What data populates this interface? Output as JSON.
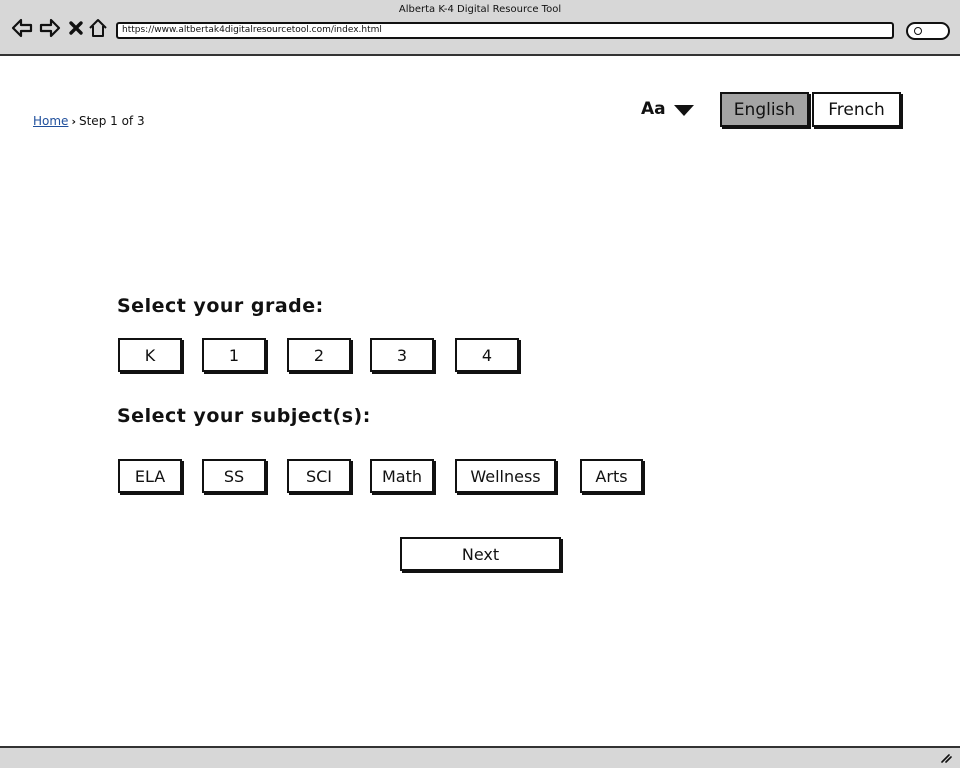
{
  "browser": {
    "window_title": "Alberta K-4 Digital Resource Tool",
    "url": "https://www.altbertak4digitalresourcetool.com/index.html"
  },
  "breadcrumb": {
    "home": "Home",
    "current": "Step 1 of 3"
  },
  "header": {
    "font_size_label": "Aa",
    "languages": [
      {
        "label": "English",
        "selected": true
      },
      {
        "label": "French",
        "selected": false
      }
    ]
  },
  "grade": {
    "label": "Select your grade:",
    "options": [
      "K",
      "1",
      "2",
      "3",
      "4"
    ]
  },
  "subject": {
    "label": "Select your subject(s):",
    "options": [
      "ELA",
      "SS",
      "SCI",
      "Math",
      "Wellness",
      "Arts"
    ]
  },
  "actions": {
    "next": "Next"
  },
  "colors": {
    "selected_language_bg": "#a4a4a4",
    "link": "#1f4f9c",
    "chrome_bg": "#d7d7d7"
  }
}
